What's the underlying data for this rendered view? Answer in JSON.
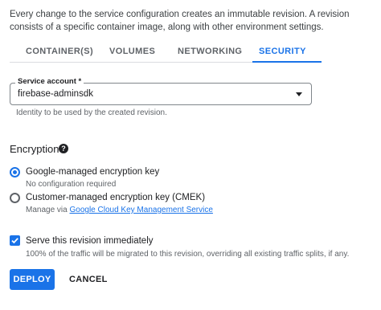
{
  "intro_text": "Every change to the service configuration creates an immutable revision. A revision consists of a specific container image, along with other environment settings.",
  "tabs": [
    {
      "label": "CONTAINER(S)",
      "active": false
    },
    {
      "label": "VOLUMES",
      "active": false
    },
    {
      "label": "NETWORKING",
      "active": false
    },
    {
      "label": "SECURITY",
      "active": true
    }
  ],
  "service_account": {
    "label": "Service account *",
    "value": "firebase-adminsdk",
    "help": "Identity to be used by the created revision."
  },
  "encryption": {
    "title": "Encryption",
    "help_icon": "question-circle-icon",
    "options": [
      {
        "label": "Google-managed encryption key",
        "sub": "No configuration required",
        "checked": true
      },
      {
        "label": "Customer-managed encryption key (CMEK)",
        "sub_prefix": "Manage via ",
        "sub_link": "Google Cloud Key Management Service",
        "checked": false
      }
    ]
  },
  "serve": {
    "label": "Serve this revision immediately",
    "sub": "100% of the traffic will be migrated to this revision, overriding all existing traffic splits, if any.",
    "checked": true
  },
  "actions": {
    "deploy": "DEPLOY",
    "cancel": "CANCEL"
  },
  "colors": {
    "accent": "#1a73e8",
    "text": "#202124",
    "muted": "#5f6368"
  }
}
